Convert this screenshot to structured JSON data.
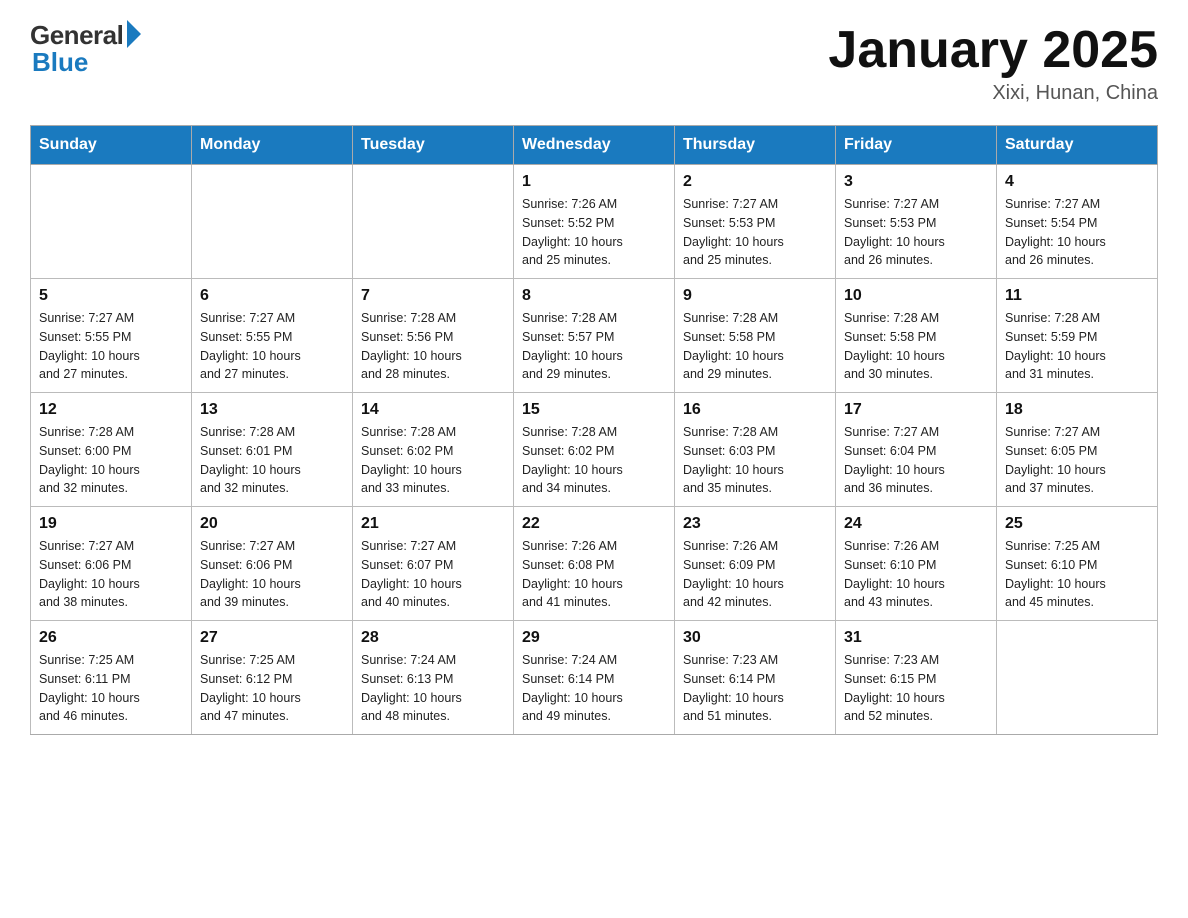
{
  "header": {
    "logo_general": "General",
    "logo_blue": "Blue",
    "month_title": "January 2025",
    "location": "Xixi, Hunan, China"
  },
  "days_of_week": [
    "Sunday",
    "Monday",
    "Tuesday",
    "Wednesday",
    "Thursday",
    "Friday",
    "Saturday"
  ],
  "weeks": [
    [
      {
        "day": "",
        "info": ""
      },
      {
        "day": "",
        "info": ""
      },
      {
        "day": "",
        "info": ""
      },
      {
        "day": "1",
        "info": "Sunrise: 7:26 AM\nSunset: 5:52 PM\nDaylight: 10 hours\nand 25 minutes."
      },
      {
        "day": "2",
        "info": "Sunrise: 7:27 AM\nSunset: 5:53 PM\nDaylight: 10 hours\nand 25 minutes."
      },
      {
        "day": "3",
        "info": "Sunrise: 7:27 AM\nSunset: 5:53 PM\nDaylight: 10 hours\nand 26 minutes."
      },
      {
        "day": "4",
        "info": "Sunrise: 7:27 AM\nSunset: 5:54 PM\nDaylight: 10 hours\nand 26 minutes."
      }
    ],
    [
      {
        "day": "5",
        "info": "Sunrise: 7:27 AM\nSunset: 5:55 PM\nDaylight: 10 hours\nand 27 minutes."
      },
      {
        "day": "6",
        "info": "Sunrise: 7:27 AM\nSunset: 5:55 PM\nDaylight: 10 hours\nand 27 minutes."
      },
      {
        "day": "7",
        "info": "Sunrise: 7:28 AM\nSunset: 5:56 PM\nDaylight: 10 hours\nand 28 minutes."
      },
      {
        "day": "8",
        "info": "Sunrise: 7:28 AM\nSunset: 5:57 PM\nDaylight: 10 hours\nand 29 minutes."
      },
      {
        "day": "9",
        "info": "Sunrise: 7:28 AM\nSunset: 5:58 PM\nDaylight: 10 hours\nand 29 minutes."
      },
      {
        "day": "10",
        "info": "Sunrise: 7:28 AM\nSunset: 5:58 PM\nDaylight: 10 hours\nand 30 minutes."
      },
      {
        "day": "11",
        "info": "Sunrise: 7:28 AM\nSunset: 5:59 PM\nDaylight: 10 hours\nand 31 minutes."
      }
    ],
    [
      {
        "day": "12",
        "info": "Sunrise: 7:28 AM\nSunset: 6:00 PM\nDaylight: 10 hours\nand 32 minutes."
      },
      {
        "day": "13",
        "info": "Sunrise: 7:28 AM\nSunset: 6:01 PM\nDaylight: 10 hours\nand 32 minutes."
      },
      {
        "day": "14",
        "info": "Sunrise: 7:28 AM\nSunset: 6:02 PM\nDaylight: 10 hours\nand 33 minutes."
      },
      {
        "day": "15",
        "info": "Sunrise: 7:28 AM\nSunset: 6:02 PM\nDaylight: 10 hours\nand 34 minutes."
      },
      {
        "day": "16",
        "info": "Sunrise: 7:28 AM\nSunset: 6:03 PM\nDaylight: 10 hours\nand 35 minutes."
      },
      {
        "day": "17",
        "info": "Sunrise: 7:27 AM\nSunset: 6:04 PM\nDaylight: 10 hours\nand 36 minutes."
      },
      {
        "day": "18",
        "info": "Sunrise: 7:27 AM\nSunset: 6:05 PM\nDaylight: 10 hours\nand 37 minutes."
      }
    ],
    [
      {
        "day": "19",
        "info": "Sunrise: 7:27 AM\nSunset: 6:06 PM\nDaylight: 10 hours\nand 38 minutes."
      },
      {
        "day": "20",
        "info": "Sunrise: 7:27 AM\nSunset: 6:06 PM\nDaylight: 10 hours\nand 39 minutes."
      },
      {
        "day": "21",
        "info": "Sunrise: 7:27 AM\nSunset: 6:07 PM\nDaylight: 10 hours\nand 40 minutes."
      },
      {
        "day": "22",
        "info": "Sunrise: 7:26 AM\nSunset: 6:08 PM\nDaylight: 10 hours\nand 41 minutes."
      },
      {
        "day": "23",
        "info": "Sunrise: 7:26 AM\nSunset: 6:09 PM\nDaylight: 10 hours\nand 42 minutes."
      },
      {
        "day": "24",
        "info": "Sunrise: 7:26 AM\nSunset: 6:10 PM\nDaylight: 10 hours\nand 43 minutes."
      },
      {
        "day": "25",
        "info": "Sunrise: 7:25 AM\nSunset: 6:10 PM\nDaylight: 10 hours\nand 45 minutes."
      }
    ],
    [
      {
        "day": "26",
        "info": "Sunrise: 7:25 AM\nSunset: 6:11 PM\nDaylight: 10 hours\nand 46 minutes."
      },
      {
        "day": "27",
        "info": "Sunrise: 7:25 AM\nSunset: 6:12 PM\nDaylight: 10 hours\nand 47 minutes."
      },
      {
        "day": "28",
        "info": "Sunrise: 7:24 AM\nSunset: 6:13 PM\nDaylight: 10 hours\nand 48 minutes."
      },
      {
        "day": "29",
        "info": "Sunrise: 7:24 AM\nSunset: 6:14 PM\nDaylight: 10 hours\nand 49 minutes."
      },
      {
        "day": "30",
        "info": "Sunrise: 7:23 AM\nSunset: 6:14 PM\nDaylight: 10 hours\nand 51 minutes."
      },
      {
        "day": "31",
        "info": "Sunrise: 7:23 AM\nSunset: 6:15 PM\nDaylight: 10 hours\nand 52 minutes."
      },
      {
        "day": "",
        "info": ""
      }
    ]
  ]
}
